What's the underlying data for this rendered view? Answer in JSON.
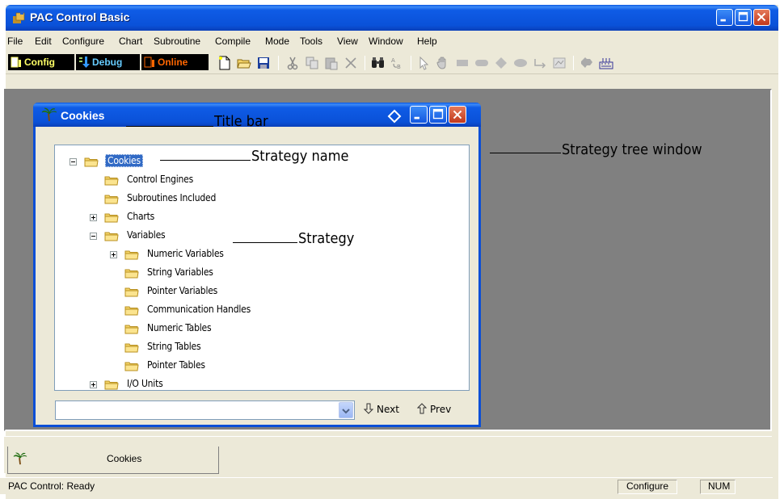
{
  "app": {
    "title": "PAC Control Basic"
  },
  "menu": [
    "File",
    "Edit",
    "Configure",
    "Chart",
    "Subroutine",
    "Compile",
    "Mode",
    "Tools",
    "View",
    "Window",
    "Help"
  ],
  "modes": {
    "config": "Config",
    "debug": "Debug",
    "online": "Online"
  },
  "toolbar_icons": [
    "new-file-icon",
    "open-folder-icon",
    "save-icon",
    "cut-icon",
    "copy-icon",
    "paste-icon",
    "delete-icon",
    "find-icon",
    "replace-icon",
    "select-pointer-icon",
    "hand-pan-icon",
    "block-icon",
    "oval-block-icon",
    "diamond-condition-icon",
    "continue-block-icon",
    "connection-icon",
    "text-icon",
    "zoom-icon",
    "keyboard-icon"
  ],
  "child": {
    "title": "Cookies",
    "tree": [
      {
        "label": "Cookies",
        "level": 0,
        "expander": "minus",
        "selected": true
      },
      {
        "label": "Control Engines",
        "level": 1,
        "expander": null
      },
      {
        "label": "Subroutines Included",
        "level": 1,
        "expander": null
      },
      {
        "label": "Charts",
        "level": 1,
        "expander": "plus"
      },
      {
        "label": "Variables",
        "level": 1,
        "expander": "minus"
      },
      {
        "label": "Numeric Variables",
        "level": 2,
        "expander": "plus"
      },
      {
        "label": "String Variables",
        "level": 2,
        "expander": null
      },
      {
        "label": "Pointer Variables",
        "level": 2,
        "expander": null
      },
      {
        "label": "Communication Handles",
        "level": 2,
        "expander": null
      },
      {
        "label": "Numeric Tables",
        "level": 2,
        "expander": null
      },
      {
        "label": "String Tables",
        "level": 2,
        "expander": null
      },
      {
        "label": "Pointer Tables",
        "level": 2,
        "expander": null
      },
      {
        "label": "I/O Units",
        "level": 1,
        "expander": "plus"
      }
    ],
    "find_value": "",
    "next_label": "Next",
    "prev_label": "Prev"
  },
  "callouts": {
    "title_bar": "Title bar",
    "strategy_name": "Strategy name",
    "strategy": "Strategy",
    "strategy_tree_window": "Strategy tree window"
  },
  "tab": {
    "label": "Cookies"
  },
  "status": {
    "message": "PAC Control: Ready",
    "mode": "Configure",
    "num": "NUM"
  },
  "colors": {
    "titlebar": "#0a51d8",
    "selection": "#316ac5",
    "mdi_background": "#808080",
    "folder": "#f5d56a"
  }
}
